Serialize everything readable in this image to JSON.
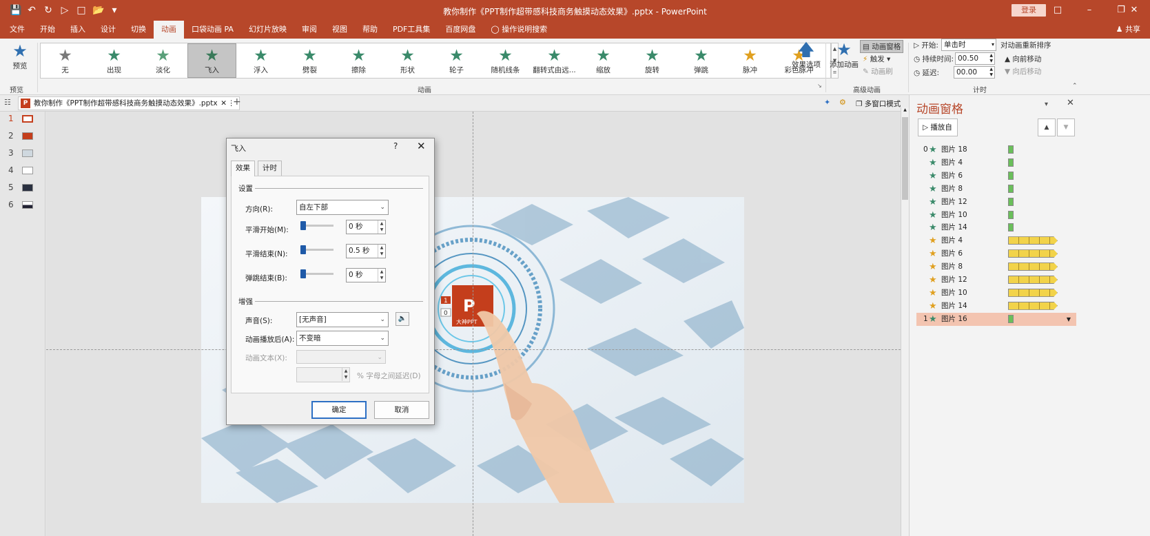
{
  "window": {
    "title": "教你制作《PPT制作超带感科技商务触摸动态效果》.pptx - PowerPoint",
    "login_label": "登录",
    "share_label": "共享",
    "qat": [
      "save-icon",
      "undo-icon",
      "redo-icon",
      "present-icon",
      "new-icon",
      "open-icon",
      "customize-icon"
    ]
  },
  "tabs": [
    "文件",
    "开始",
    "插入",
    "设计",
    "切换",
    "动画",
    "口袋动画 PA",
    "幻灯片放映",
    "审阅",
    "视图",
    "帮助",
    "PDF工具集",
    "百度网盘",
    "操作说明搜索"
  ],
  "ribbon": {
    "preview_label": "预览",
    "preview_group": "预览",
    "effects": [
      {
        "label": "无",
        "color": "#7a7a7a"
      },
      {
        "label": "出现",
        "color": "#3a8a6a"
      },
      {
        "label": "淡化",
        "color": "#5aa07a"
      },
      {
        "label": "飞入",
        "color": "#3a7a5a"
      },
      {
        "label": "浮入",
        "color": "#3a8a6a"
      },
      {
        "label": "劈裂",
        "color": "#3a8a6a"
      },
      {
        "label": "擦除",
        "color": "#3a8a6a"
      },
      {
        "label": "形状",
        "color": "#3a8a6a"
      },
      {
        "label": "轮子",
        "color": "#3a8a6a"
      },
      {
        "label": "随机线条",
        "color": "#3a8a6a"
      },
      {
        "label": "翻转式由远...",
        "color": "#3a8a6a"
      },
      {
        "label": "缩放",
        "color": "#3a8a6a"
      },
      {
        "label": "旋转",
        "color": "#3a8a6a"
      },
      {
        "label": "弹跳",
        "color": "#3a8a6a"
      },
      {
        "label": "脉冲",
        "color": "#e0a020"
      },
      {
        "label": "彩色脉冲",
        "color": "#e0a020"
      }
    ],
    "selected_effect": "飞入",
    "effect_options_label": "效果选项",
    "animation_group": "动画",
    "add_animation_label": "添加动画",
    "animation_pane_label": "动画窗格",
    "trigger_label": "触发",
    "painter_label": "动画刷",
    "advanced_group": "高级动画",
    "start_label": "开始:",
    "start_value": "单击时",
    "duration_label": "持续时间:",
    "duration_value": "00.50",
    "delay_label": "延迟:",
    "delay_value": "00.00",
    "reorder_label": "对动画重新排序",
    "move_earlier": "向前移动",
    "move_later": "向后移动",
    "timing_group": "计时"
  },
  "doctab": {
    "label": "教你制作《PPT制作超带感科技商务触摸动态效果》.pptx",
    "close": "✕",
    "add": "+",
    "multiwindow_label": "多窗口模式"
  },
  "slides": [
    "1",
    "2",
    "3",
    "4",
    "5",
    "6"
  ],
  "slide": {
    "tag1": "1",
    "tag0": "0",
    "logo_text": "P",
    "logo_caption": "大神PPT"
  },
  "dialog": {
    "title": "飞入",
    "help": "?",
    "close": "✕",
    "tab_effect": "效果",
    "tab_timing": "计时",
    "section_settings": "设置",
    "direction_label": "方向(R):",
    "direction_value": "自左下部",
    "smooth_start_label": "平滑开始(M):",
    "smooth_start_value": "0 秒",
    "smooth_end_label": "平滑结束(N):",
    "smooth_end_value": "0.5 秒",
    "bounce_end_label": "弹跳结束(B):",
    "bounce_end_value": "0 秒",
    "section_enhance": "增强",
    "sound_label": "声音(S):",
    "sound_value": "[无声音]",
    "after_label": "动画播放后(A):",
    "after_value": "不变暗",
    "animate_text_label": "动画文本(X):",
    "animate_text_value": "",
    "letter_delay_label": "% 字母之间延迟(D)",
    "ok": "确定",
    "cancel": "取消"
  },
  "pane": {
    "title": "动画窗格",
    "play_label": "播放自",
    "items": [
      {
        "num": "0",
        "star_color": "#3a8a6a",
        "name": "图片 18",
        "bar_color": "#6abf5a",
        "bar_type": "small",
        "selected": false
      },
      {
        "num": "",
        "star_color": "#3a8a6a",
        "name": "图片 4",
        "bar_color": "#6abf5a",
        "bar_type": "small",
        "selected": false
      },
      {
        "num": "",
        "star_color": "#3a8a6a",
        "name": "图片 6",
        "bar_color": "#6abf5a",
        "bar_type": "small",
        "selected": false
      },
      {
        "num": "",
        "star_color": "#3a8a6a",
        "name": "图片 8",
        "bar_color": "#6abf5a",
        "bar_type": "small",
        "selected": false
      },
      {
        "num": "",
        "star_color": "#3a8a6a",
        "name": "图片 12",
        "bar_color": "#6abf5a",
        "bar_type": "small",
        "selected": false
      },
      {
        "num": "",
        "star_color": "#3a8a6a",
        "name": "图片 10",
        "bar_color": "#6abf5a",
        "bar_type": "small",
        "selected": false
      },
      {
        "num": "",
        "star_color": "#3a8a6a",
        "name": "图片 14",
        "bar_color": "#6abf5a",
        "bar_type": "small",
        "selected": false
      },
      {
        "num": "",
        "star_color": "#e0a020",
        "name": "图片 4",
        "bar_color": "#f2d34a",
        "bar_type": "long",
        "selected": false
      },
      {
        "num": "",
        "star_color": "#e0a020",
        "name": "图片 6",
        "bar_color": "#f2d34a",
        "bar_type": "long",
        "selected": false
      },
      {
        "num": "",
        "star_color": "#e0a020",
        "name": "图片 8",
        "bar_color": "#f2d34a",
        "bar_type": "long",
        "selected": false
      },
      {
        "num": "",
        "star_color": "#e0a020",
        "name": "图片 12",
        "bar_color": "#f2d34a",
        "bar_type": "long",
        "selected": false
      },
      {
        "num": "",
        "star_color": "#e0a020",
        "name": "图片 10",
        "bar_color": "#f2d34a",
        "bar_type": "long",
        "selected": false
      },
      {
        "num": "",
        "star_color": "#e0a020",
        "name": "图片 14",
        "bar_color": "#f2d34a",
        "bar_type": "long",
        "selected": false
      },
      {
        "num": "1",
        "star_color": "#3a8a6a",
        "name": "图片 16",
        "bar_color": "#6abf5a",
        "bar_type": "small",
        "selected": true
      }
    ]
  },
  "colors": {
    "brand": "#b7472a",
    "accent": "#2c6fc4"
  }
}
